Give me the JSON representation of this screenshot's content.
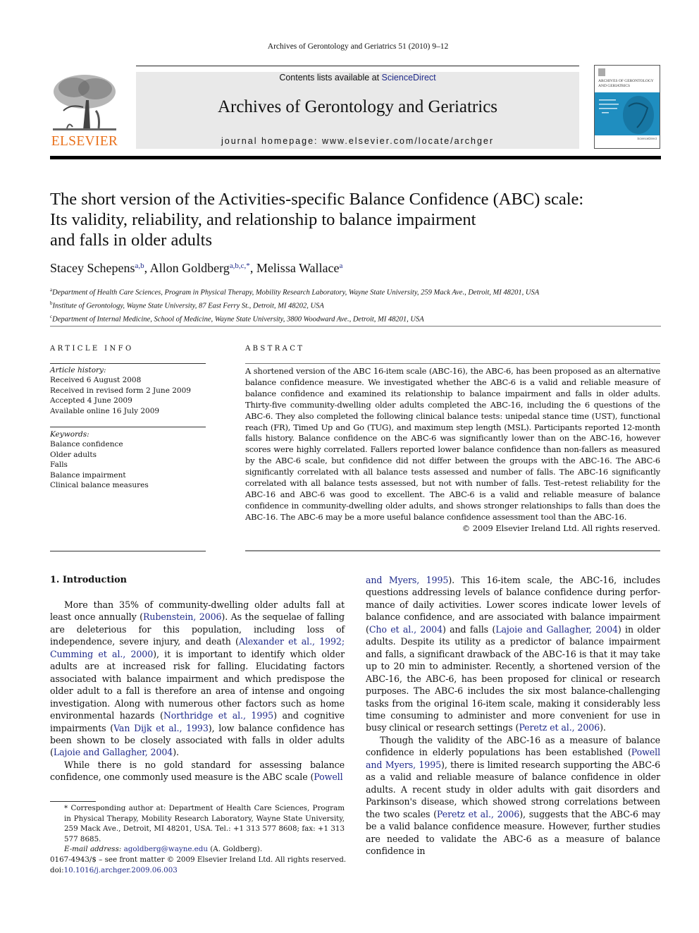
{
  "header": {
    "running_head": "Archives of Gerontology and Geriatrics 51 (2010) 9–12",
    "contents_prefix": "Contents lists available at ",
    "contents_link": "ScienceDirect",
    "journal_title": "Archives of Gerontology and Geriatrics",
    "homepage": "journal homepage: www.elsevier.com/locate/archger",
    "publisher_logo": "ELSEVIER",
    "cover_title_line1": "ARCHIVES OF GERONTOLOGY",
    "cover_title_line2": "AND GERIATRICS",
    "colors": {
      "elsevier_orange": "#e9711c",
      "link_blue": "#1f2a8a",
      "banner_gray": "#e9e9e9",
      "cover_blue": "#1f8ec0"
    }
  },
  "article": {
    "title_lines": [
      "The short version of the Activities-specific Balance Confidence (ABC) scale:",
      "Its validity, reliability, and relationship to balance impairment",
      "and falls in older adults"
    ],
    "authors": [
      {
        "name": "Stacey Schepens",
        "sup": "a,b",
        "sep": ", "
      },
      {
        "name": "Allon Goldberg",
        "sup": "a,b,c,*",
        "sep": ", "
      },
      {
        "name": "Melissa Wallace",
        "sup": "a",
        "sep": ""
      }
    ],
    "affiliations": [
      {
        "key": "a",
        "text": "Department of Health Care Sciences, Program in Physical Therapy, Mobility Research Laboratory, Wayne State University, 259 Mack Ave., Detroit, MI 48201, USA"
      },
      {
        "key": "b",
        "text": "Institute of Gerontology, Wayne State University, 87 East Ferry St., Detroit, MI 48202, USA"
      },
      {
        "key": "c",
        "text": "Department of Internal Medicine, School of Medicine, Wayne State University, 3800 Woodward Ave., Detroit, MI 48201, USA"
      }
    ]
  },
  "article_info": {
    "label": "ARTICLE INFO",
    "history_heading": "Article history:",
    "history": [
      "Received 6 August 2008",
      "Received in revised form 2 June 2009",
      "Accepted 4 June 2009",
      "Available online 16 July 2009"
    ],
    "keywords_heading": "Keywords:",
    "keywords": [
      "Balance confidence",
      "Older adults",
      "Falls",
      "Balance impairment",
      "Clinical balance measures"
    ]
  },
  "abstract": {
    "label": "ABSTRACT",
    "text": "A shortened version of the ABC 16-item scale (ABC-16), the ABC-6, has been proposed as an alternative balance confidence measure. We investigated whether the ABC-6 is a valid and reliable measure of balance confidence and examined its relationship to balance impairment and falls in older adults. Thirty-five community-dwelling older adults completed the ABC-16, including the 6 questions of the ABC-6. They also completed the following clinical balance tests: unipedal stance time (UST), functional reach (FR), Timed Up and Go (TUG), and maximum step length (MSL). Participants reported 12-month falls history. Balance confidence on the ABC-6 was significantly lower than on the ABC-16, however scores were highly correlated. Fallers reported lower balance confidence than non-fallers as measured by the ABC-6 scale, but confidence did not differ between the groups with the ABC-16. The ABC-6 significantly correlated with all balance tests assessed and number of falls. The ABC-16 significantly correlated with all balance tests assessed, but not with number of falls. Test–retest reliability for the ABC-16 and ABC-6 was good to excellent. The ABC-6 is a valid and reliable measure of balance confidence in community-dwelling older adults, and shows stronger relationships to falls than does the ABC-16. The ABC-6 may be a more useful balance confidence assessment tool than the ABC-16.",
    "copyright": "© 2009 Elsevier Ireland Ltd. All rights reserved."
  },
  "body": {
    "intro_heading": "1. Introduction",
    "left_paragraphs": [
      [
        {
          "t": "More than 35% of community-dwelling older adults fall at least once annually ("
        },
        {
          "t": "Rubenstein, 2006",
          "link": true
        },
        {
          "t": "). As the sequelae of falling are deleterious for this population, including loss of independence, severe injury, and death ("
        },
        {
          "t": "Alexander et al., 1992; Cumming et al., 2000",
          "link": true
        },
        {
          "t": "), it is important to identify which older adults are at increased risk for falling. Elucidating factors associated with balance impairment and which predispose the older adult to a fall is therefore an area of intense and ongoing investigation. Along with numerous other factors such as home environmental hazards ("
        },
        {
          "t": "Northridge et al., 1995",
          "link": true
        },
        {
          "t": ") and cognitive impairments ("
        },
        {
          "t": "Van Dijk et al., 1993",
          "link": true
        },
        {
          "t": "), low balance confidence has been shown to be closely associated with falls in older adults ("
        },
        {
          "t": "Lajoie and Gallagher, 2004",
          "link": true
        },
        {
          "t": ")."
        }
      ],
      [
        {
          "t": "While there is no gold standard for assessing balance confidence, one commonly used measure is the ABC scale ("
        },
        {
          "t": "Powell",
          "link": true
        }
      ]
    ],
    "right_paragraphs": [
      [
        {
          "t": "and Myers, 1995",
          "link": true
        },
        {
          "t": "). This 16-item scale, the ABC-16, includes questions addressing levels of balance confidence during perfor-mance of daily activities. Lower scores indicate lower levels of balance confidence, and are associated with balance impairment ("
        },
        {
          "t": "Cho et al., 2004",
          "link": true
        },
        {
          "t": ") and falls ("
        },
        {
          "t": "Lajoie and Gallagher, 2004",
          "link": true
        },
        {
          "t": ") in older adults. Despite its utility as a predictor of balance impairment and falls, a significant drawback of the ABC-16 is that it may take up to 20 min to administer. Recently, a shortened version of the ABC-16, the ABC-6, has been proposed for clinical or research purposes. The ABC-6 includes the six most balance-challenging tasks from the original 16-item scale, making it considerably less time consuming to administer and more convenient for use in busy clinical or research settings ("
        },
        {
          "t": "Peretz et al., 2006",
          "link": true
        },
        {
          "t": ")."
        }
      ],
      [
        {
          "t": "Though the validity of the ABC-16 as a measure of balance confidence in elderly populations has been established ("
        },
        {
          "t": "Powell and Myers, 1995",
          "link": true
        },
        {
          "t": "), there is limited research supporting the ABC-6 as a valid and reliable measure of balance confidence in older adults. A recent study in older adults with gait disorders and Parkinson's disease, which showed strong correlations between the two scales ("
        },
        {
          "t": "Peretz et al., 2006",
          "link": true
        },
        {
          "t": "), suggests that the ABC-6 may be a valid balance confidence measure. However, further studies are needed to validate the ABC-6 as a measure of balance confidence in"
        }
      ]
    ]
  },
  "footnote": {
    "corresponding": "* Corresponding author at: Department of Health Care Sciences, Program in Physical Therapy, Mobility Research Laboratory, Wayne State University, 259 Mack Ave., Detroit, MI 48201, USA. Tel.: +1 313 577 8608; fax: +1 313 577 8685.",
    "email_label": "E-mail address: ",
    "email": "agoldberg@wayne.edu",
    "email_suffix": " (A. Goldberg).",
    "issn_line": "0167-4943/$ – see front matter © 2009 Elsevier Ireland Ltd. All rights reserved.",
    "doi_prefix": "doi:",
    "doi": "10.1016/j.archger.2009.06.003"
  }
}
